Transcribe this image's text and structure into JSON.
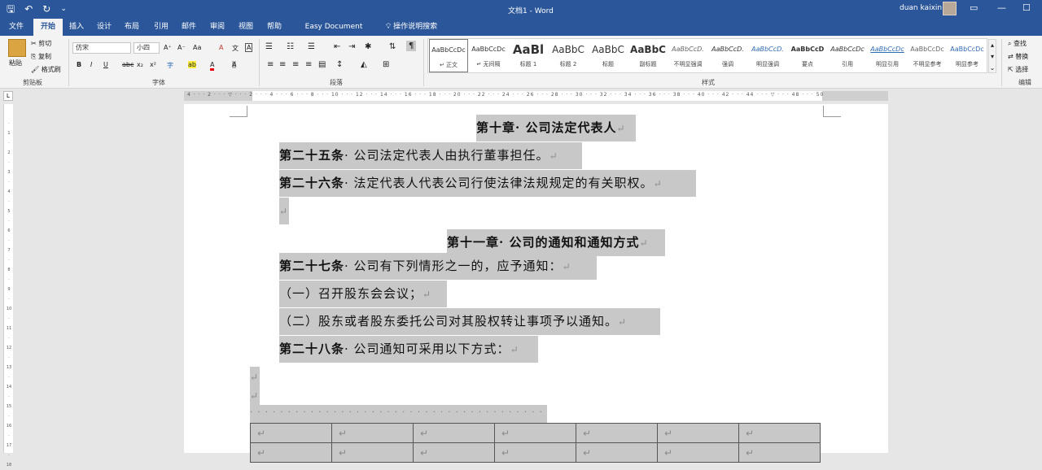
{
  "titlebar": {
    "doc_title": "文档1  -  Word",
    "user_name": "duan kaixin",
    "qat_save": "🖫",
    "qat_undo": "↶",
    "qat_redo": "↻",
    "qat_more": "⌄",
    "restore_icon": "▭",
    "minimize_icon": "—",
    "maximize_icon": "☐"
  },
  "tabs": [
    "文件",
    "开始",
    "插入",
    "设计",
    "布局",
    "引用",
    "邮件",
    "审阅",
    "视图",
    "帮助",
    "Easy Document Creator",
    "操作说明搜索"
  ],
  "ribbon": {
    "clipboard": {
      "paste": "粘贴",
      "cut": "剪切",
      "copy": "复制",
      "format_painter": "格式刷",
      "label": "剪贴板"
    },
    "font": {
      "font_name": "仿宋",
      "font_size": "小四",
      "label": "字体",
      "bold": "B",
      "italic": "I",
      "underline": "U",
      "strike": "abc",
      "sub": "x₂",
      "sup": "x²",
      "grow": "A⁺",
      "shrink": "A⁻",
      "case": "Aa",
      "clear": "A",
      "phonetic": "文",
      "border": "A",
      "color": "A",
      "highlight": "ab",
      "shade": "A",
      "circle": "字"
    },
    "paragraph": {
      "label": "段落"
    },
    "styles": {
      "label": "样式",
      "items": [
        {
          "preview": "AaBbCcDc",
          "name": "↵ 正文"
        },
        {
          "preview": "AaBbCcDc",
          "name": "↵ 无间隔"
        },
        {
          "preview": "AaBl",
          "name": "标题 1"
        },
        {
          "preview": "AaBbC",
          "name": "标题 2"
        },
        {
          "preview": "AaBbC",
          "name": "标题"
        },
        {
          "preview": "AaBbC",
          "name": "副标题"
        },
        {
          "preview": "AaBbCcD.",
          "name": "不明显强调"
        },
        {
          "preview": "AaBbCcD.",
          "name": "强调"
        },
        {
          "preview": "AaBbCcD.",
          "name": "明显强调"
        },
        {
          "preview": "AaBbCcD",
          "name": "要点"
        },
        {
          "preview": "AaBbCcDc",
          "name": "引用"
        },
        {
          "preview": "AaBbCcDc",
          "name": "明显引用"
        },
        {
          "preview": "AaBbCcDc",
          "name": "不明显参考"
        },
        {
          "preview": "AaBbCcDc",
          "name": "明显参考"
        }
      ]
    },
    "editing": {
      "find": "查找",
      "replace": "替换",
      "select": "选择",
      "label": "编辑"
    }
  },
  "ruler": {
    "h_ticks": "4 · · · 2 · · · ▽ · · · 2 · · · 4 · · · 6 · · · 8 · · · 10 · · · 12 · · · 14 · · · 16 · · · 18 · · · 20 · · · 22 · · · 24 · · · 26 · · · 28 · · · 30 · · · 32 · · · 34 · · · 36 · · · 38 · · · 40 · · · 42 · · · 44 · · · ▽ · · · 48 · · · 50",
    "v_ticks": [
      "·",
      "1",
      "·",
      "2",
      "·",
      "3",
      "·",
      "4",
      "·",
      "5",
      "·",
      "6",
      "·",
      "7",
      "·",
      "8",
      "·",
      "9",
      "·",
      "10",
      "·",
      "11",
      "·",
      "12",
      "·",
      "13",
      "·",
      "14",
      "·",
      "15",
      "·",
      "16",
      "·",
      "17",
      "·",
      "18"
    ],
    "corner": "L"
  },
  "document": {
    "pilcrow": "↵",
    "chapter10": "第十章· 公司法定代表人",
    "art25_head": "第二十五条",
    "art25_body": "· 公司法定代表人由执行董事担任。",
    "art26_head": "第二十六条",
    "art26_body": "· 法定代表人代表公司行使法律法规规定的有关职权。",
    "chapter11": "第十一章· 公司的通知和通知方式",
    "art27_head": "第二十七条",
    "art27_body": "· 公司有下列情形之一的，应予通知：",
    "item1": "（一）召开股东会会议；",
    "item2": "（二）股东或者股东委托公司对其股权转让事项予以通知。",
    "art28_head": "第二十八条",
    "art28_body": "· 公司通知可采用以下方式：",
    "dots": "· · · · · · · · · · · · · · · · · · · · · · · · · · · · · · · · · · · · · · · · · · · · · · · · · · ↵"
  }
}
